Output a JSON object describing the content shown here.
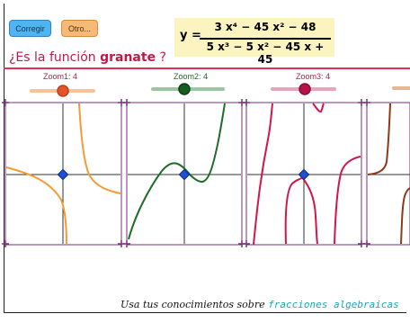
{
  "buttons": {
    "check_label": "Corregir",
    "other_label": "Otro..."
  },
  "formula": {
    "lhs": "y =",
    "numerator": "3 x⁴ − 45 x² − 48",
    "denominator": "5 x³ − 5 x² − 45 x + 45"
  },
  "question": {
    "prefix": "¿Es la función ",
    "keyword": "granate",
    "suffix": " ?"
  },
  "sliders": [
    {
      "label": "Zoom1: 4",
      "value": 4,
      "color": "#f0a060"
    },
    {
      "label": "Zoom2: 4",
      "value": 4,
      "color": "#1e6b2a"
    },
    {
      "label": "Zoom3: 4",
      "value": 4,
      "color": "#c21847"
    }
  ],
  "footer": {
    "text": "Usa tus conocimientos sobre ",
    "link": "fracciones algebraicas"
  },
  "colors": {
    "accent": "#c21847",
    "graph_border": "#7a2f7a",
    "orange": "#f59b32",
    "green": "#1e6b2a",
    "crimson": "#d0164a",
    "brown": "#8b3a1a",
    "point": "#1d4fd6"
  }
}
